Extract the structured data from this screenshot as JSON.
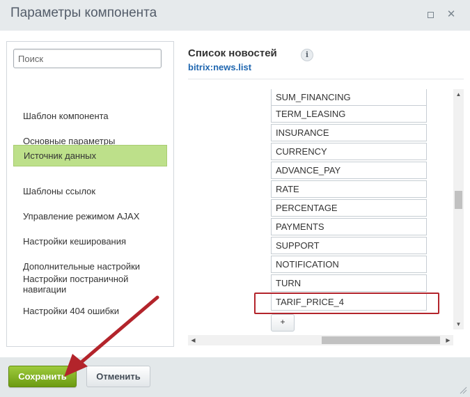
{
  "window": {
    "title": "Параметры компонента",
    "maximize_icon": "maximize-icon",
    "close_icon": "close-icon"
  },
  "sidebar": {
    "search_placeholder": "Поиск",
    "items": [
      {
        "label": "Шаблон компонента",
        "active": false
      },
      {
        "label": "Основные параметры",
        "active": false
      },
      {
        "label": "Источник данных",
        "active": true
      },
      {
        "label": "Шаблоны ссылок",
        "active": false
      },
      {
        "label": "Управление режимом AJAX",
        "active": false
      },
      {
        "label": "Настройки кеширования",
        "active": false
      },
      {
        "label": "Дополнительные настройки",
        "active": false
      },
      {
        "label": "Настройки постраничной навигации",
        "active": false
      },
      {
        "label": "Настройки 404 ошибки",
        "active": false
      }
    ]
  },
  "main": {
    "title": "Список новостей",
    "subtitle": "bitrix:news.list",
    "fields": [
      "SUM_FINANCING",
      "TERM_LEASING",
      "INSURANCE",
      "CURRENCY",
      "ADVANCE_PAY",
      "RATE",
      "PERCENTAGE",
      "PAYMENTS",
      "SUPPORT",
      "NOTIFICATION",
      "TURN",
      "TARIF_PRICE_4"
    ],
    "add_label": "+"
  },
  "footer": {
    "save_label": "Сохранить",
    "cancel_label": "Отменить"
  },
  "colors": {
    "active_item": "#bde08a",
    "save_button": "#7fae1f",
    "highlight_box": "#b3242b",
    "annotation_arrow": "#b3242b",
    "link": "#2067b0"
  }
}
